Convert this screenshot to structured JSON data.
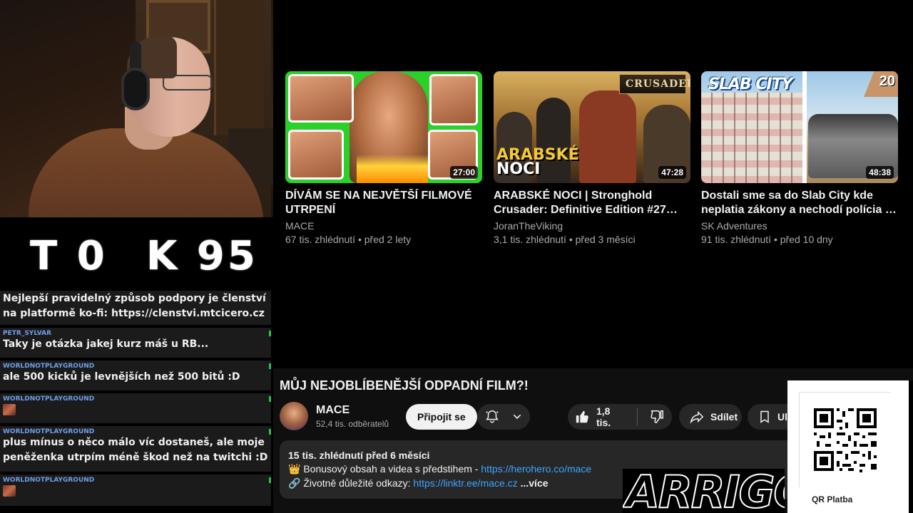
{
  "stream": {
    "score": {
      "left": "T 0",
      "right": "K 95"
    }
  },
  "chat": {
    "messages": [
      {
        "user": "",
        "text": "Nejlepší pravidelný způsob podpory je členství na platformě ko-fi: https://clenstvi.mtcicero.cz"
      },
      {
        "user": "PETR_SYLVAR",
        "text": "Taky je otázka jakej kurz máš u RB..."
      },
      {
        "user": "WORLDNOTPLAYGROUND",
        "text": "ale 500 kicků je levnějších než 500 bitů :D"
      },
      {
        "user": "WORLDNOTPLAYGROUND",
        "text": ""
      },
      {
        "user": "WORLDNOTPLAYGROUND",
        "text": "plus mínus o něco málo víc dostaneš, ale moje peněženka utrpím méně škod než na twitchi :D"
      },
      {
        "user": "WORLDNOTPLAYGROUND",
        "text": ""
      }
    ]
  },
  "recommendations": [
    {
      "title": "DÍVÁM SE NA NEJVĚTŠÍ FILMOVÉ UTRPENÍ",
      "channel": "MACE",
      "meta": "67 tis. zhlédnutí • před 2 lety",
      "duration": "27:00"
    },
    {
      "title": "ARABSKÉ NOCI | Stronghold Crusader: Definitive Edition #27 (CZ...",
      "channel": "JoranTheViking",
      "meta": "3,1 tis. zhlédnutí • před 3 měsíci",
      "duration": "47:28",
      "thumb_logo": "CRUSADER",
      "thumb_text_a": "ARABSKÉ",
      "thumb_text_b": "NOCI"
    },
    {
      "title": "Dostali sme sa do Slab City kde neplatia zákony a nechodí polícia ! ...",
      "channel": "SK Adventures",
      "meta": "91 tis. zhlédnutí • před 10 dny",
      "duration": "48:38",
      "thumb_text": "SLAB CITY",
      "thumb_number": "20"
    }
  ],
  "video": {
    "title": "MŮJ NEJOBLÍBENĚJŠÍ ODPADNÍ FILM?!",
    "channel": "MACE",
    "subscribers": "52,4 tis. odběratelů",
    "join_label": "Připojit se",
    "likes": "1,8 tis.",
    "share_label": "Sdílet",
    "save_label": "Ulo",
    "desc": {
      "views_date": "15 tis. zhlédnutí  před 6 měsíci",
      "line2_prefix": "👑 Bonusový obsah a videa s předstihem - ",
      "line2_link": "https://herohero.co/mace",
      "line3_prefix": "🔗 Životně důležité odkazy: ",
      "line3_link": "https://linktr.ee/mace.cz",
      "more": " ...více"
    }
  },
  "overlay": {
    "brand": "ARRIGOS",
    "qr_label": "QR Platba"
  },
  "colors": {
    "accent_link": "#3ea6ff",
    "chat_user": "#6f9fe8",
    "thumb_green": "#2bd12a"
  }
}
